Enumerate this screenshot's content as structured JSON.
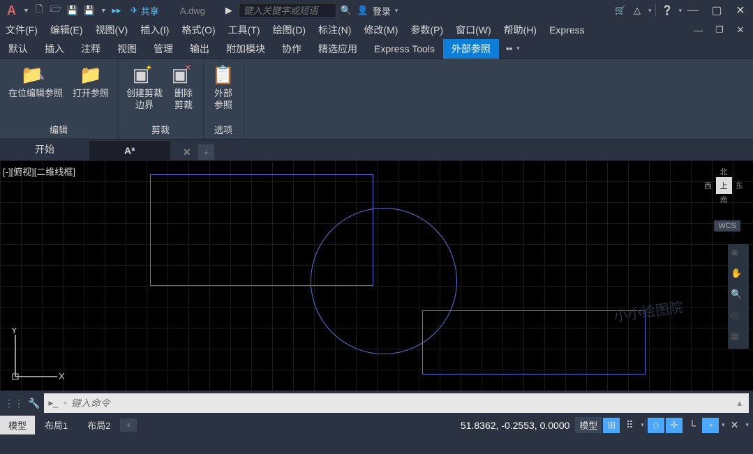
{
  "title": {
    "share": "共享",
    "filename": "A.dwg",
    "search_placeholder": "键入关键字或短语",
    "login": "登录"
  },
  "menu": [
    "文件(F)",
    "编辑(E)",
    "视图(V)",
    "插入(I)",
    "格式(O)",
    "工具(T)",
    "绘图(D)",
    "标注(N)",
    "修改(M)",
    "参数(P)",
    "窗口(W)",
    "帮助(H)",
    "Express"
  ],
  "ribbon_tabs": [
    "默认",
    "插入",
    "注释",
    "视图",
    "管理",
    "输出",
    "附加模块",
    "协作",
    "精选应用",
    "Express Tools",
    "外部参照"
  ],
  "ribbon_active": 10,
  "ribbon": {
    "panels": [
      {
        "title": "编辑",
        "buttons": [
          "在位编辑参照",
          "打开参照"
        ]
      },
      {
        "title": "剪裁",
        "buttons": [
          "创建剪裁\n边界",
          "删除\n剪裁"
        ]
      },
      {
        "title": "选项",
        "buttons": [
          "外部\n参照"
        ]
      }
    ]
  },
  "doc_tabs": {
    "start": "开始",
    "active": "A*",
    "add": "+"
  },
  "viewport_label": "[-][俯视][二维线框]",
  "wcs": "WCS",
  "navcube": {
    "n": "北",
    "s": "南",
    "e": "东",
    "w": "西",
    "top": "上"
  },
  "watermark": "小小绘图院",
  "cmd_placeholder": "键入命令",
  "status": {
    "model": "模型",
    "layout1": "布局1",
    "layout2": "布局2",
    "coords": "51.8362, -0.2553, 0.0000",
    "model_btn": "模型"
  }
}
